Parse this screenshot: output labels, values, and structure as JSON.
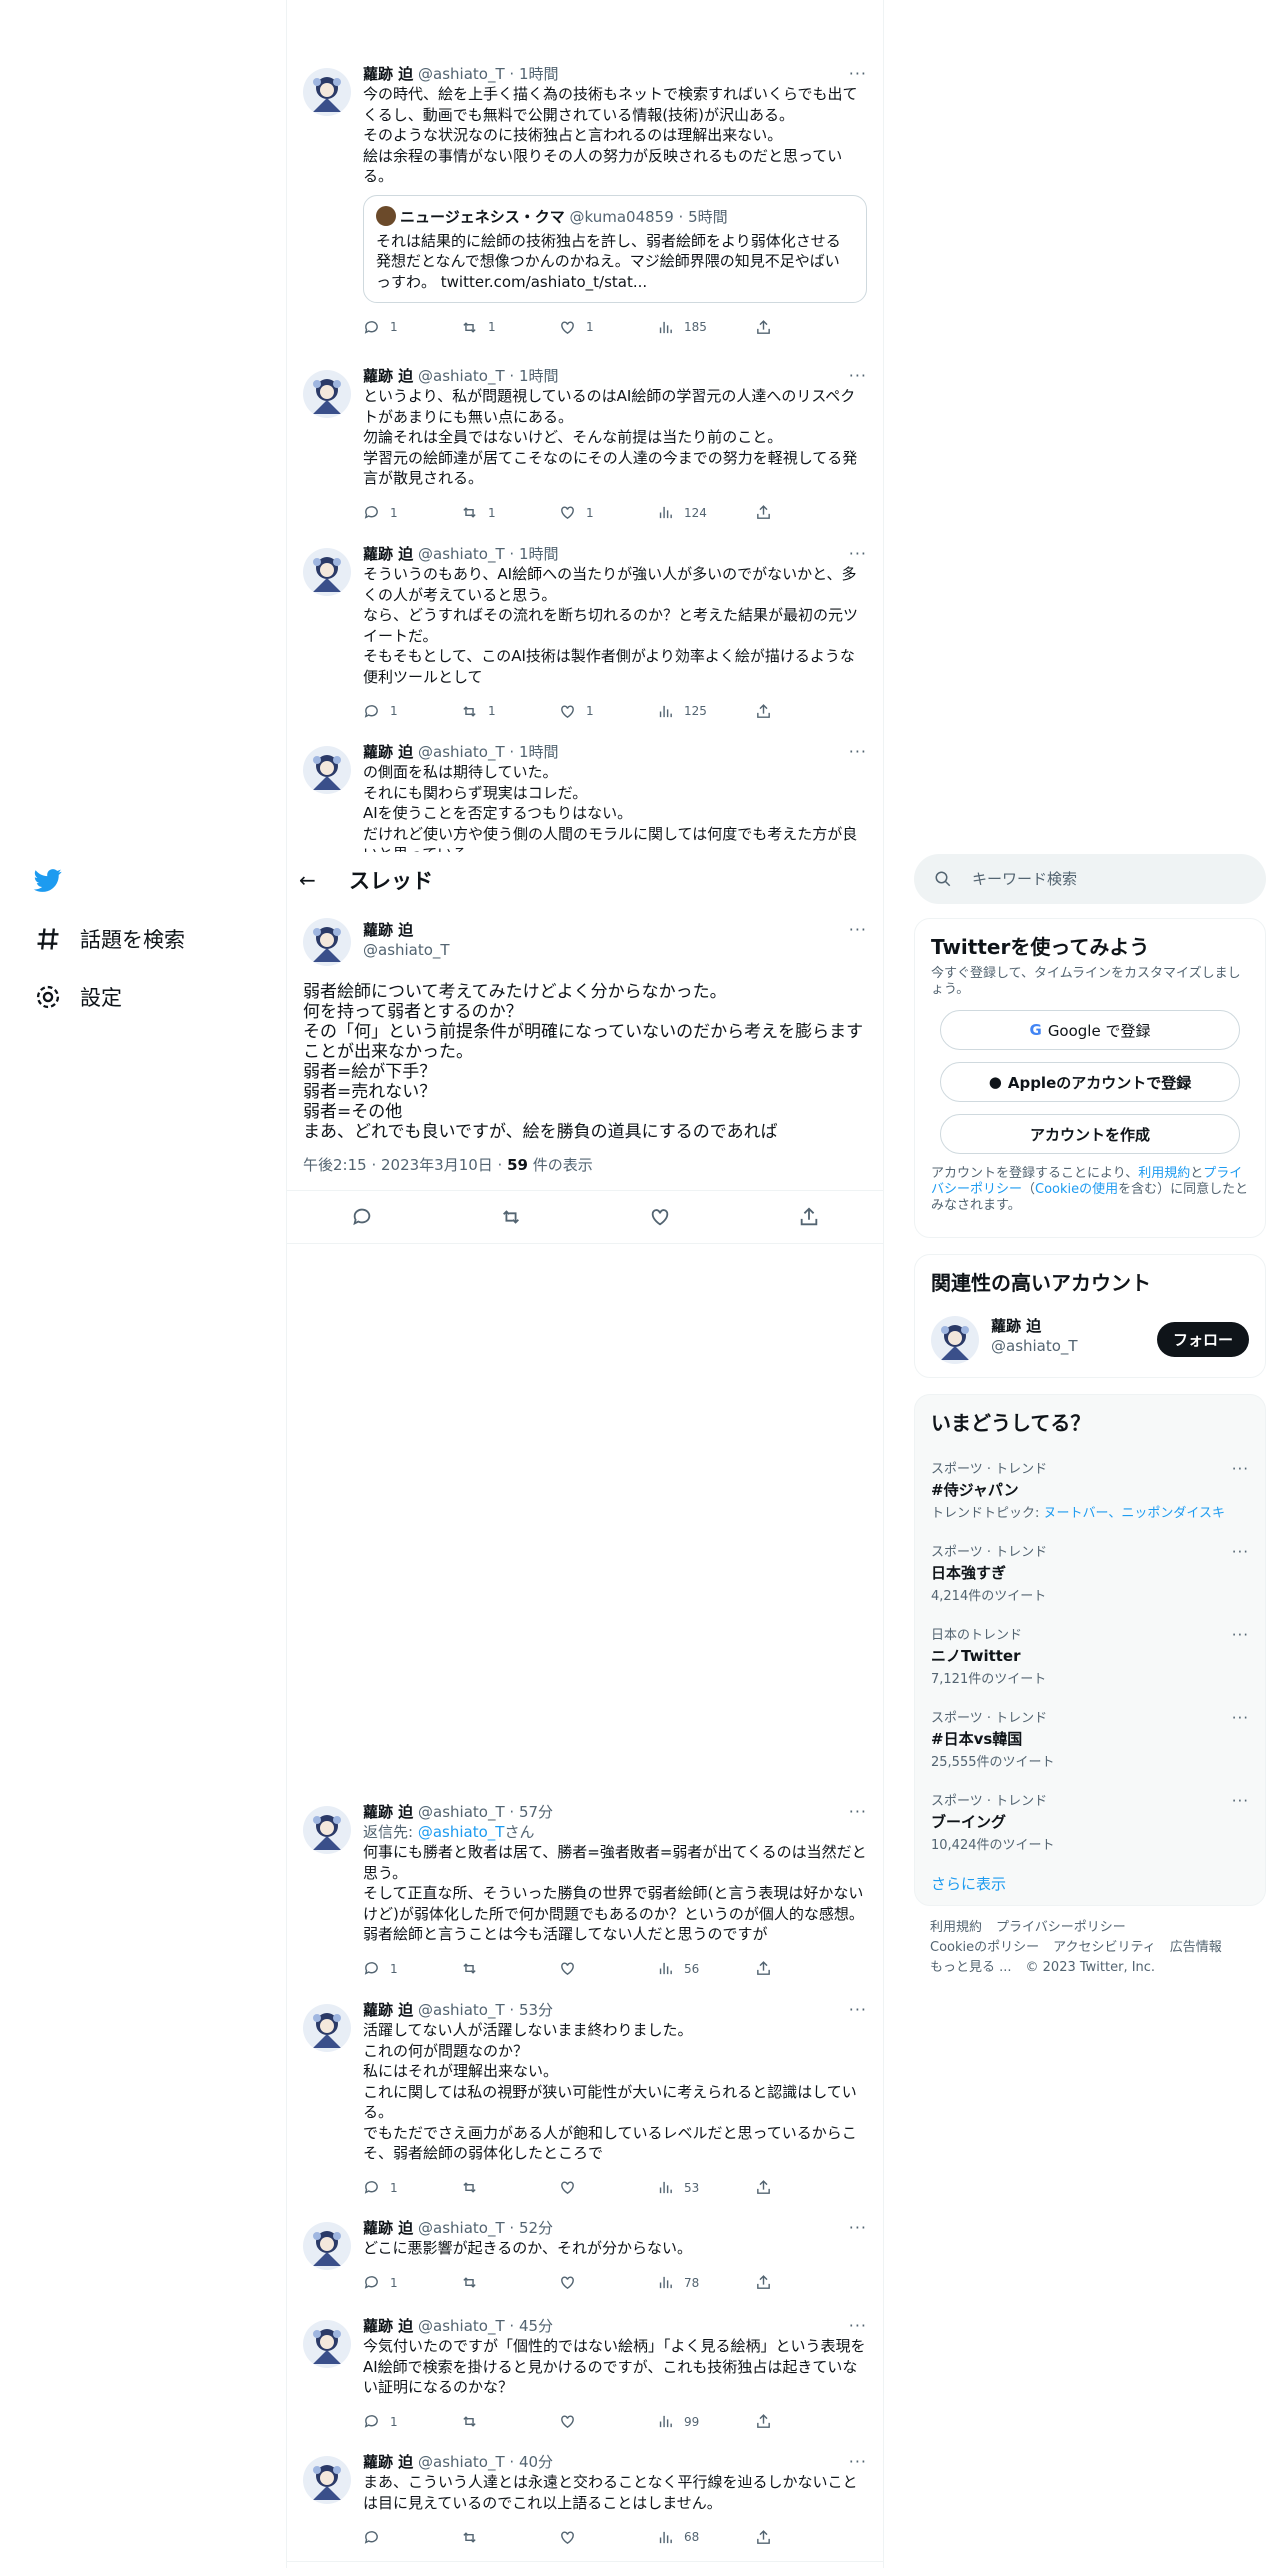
{
  "nav": {
    "items": [
      {
        "label": "話題を検索"
      },
      {
        "label": "設定"
      }
    ]
  },
  "header": {
    "title": "スレッド"
  },
  "author": {
    "name": "蘿跡 迫",
    "handle": "@ashiato_T"
  },
  "tweets_top": [
    {
      "time": "1時間",
      "text": "今の時代、絵を上手く描く為の技術もネットで検索すればいくらでも出てくるし、動画でも無料で公開されている情報(技術)が沢山ある。\nそのような状況なのに技術独占と言われるのは理解出来ない。\n絵は余程の事情がない限りその人の努力が反映されるものだと思っている。",
      "quote": {
        "name": "ニュージェネシス・クマ",
        "handle": "@kuma04859",
        "time": "5時間",
        "text": "それは結果的に絵師の技術独占を許し、弱者絵師をより弱体化させる発想だとなんで想像つかんのかねえ。マジ絵師界隈の知見不足やばいっすわ。 twitter.com/ashiato_t/stat..."
      },
      "reply": "1",
      "retweet": "1",
      "like": "1",
      "views": "185"
    },
    {
      "time": "1時間",
      "text": "というより、私が問題視しているのはAI絵師の学習元の人達へのリスペクトがあまりにも無い点にある。\n勿論それは全員ではないけど、そんな前提は当たり前のこと。\n学習元の絵師達が居てこそなのにその人達の今までの努力を軽視してる発言が散見される。",
      "reply": "1",
      "retweet": "1",
      "like": "1",
      "views": "124"
    },
    {
      "time": "1時間",
      "text": "そういうのもあり、AI絵師への当たりが強い人が多いのでがないかと、多くの人が考えていると思う。\nなら、どうすればその流れを断ち切れるのか？と考えた結果が最初の元ツイートだ。\nそもそもとして、このAI技術は製作者側がより効率よく絵が描けるような便利ツールとして",
      "reply": "1",
      "retweet": "1",
      "like": "1",
      "views": "125"
    },
    {
      "time": "1時間",
      "text": "の側面を私は期待していた。\nそれにも関わらず現実はコレだ。\nAIを使うことを否定するつもりはない。\nだけれど使い方や使う側の人間のモラルに関しては何度でも考えた方が良いと思っている。"
    }
  ],
  "main_tweet": {
    "text": "弱者絵師について考えてみたけどよく分からなかった。\n何を持って弱者とするのか？\nその「何」という前提条件が明確になっていないのだから考えを膨らますことが出来なかった。\n弱者=絵が下手？\n弱者=売れない？\n弱者=その他\nまあ、どれでも良いですが、絵を勝負の道具にするのであれば",
    "timestamp": "午後2:15 · 2023年3月10日 · ",
    "views": "59",
    "views_label": " 件の表示"
  },
  "tweets_bottom": [
    {
      "time": "57分",
      "reply_to_label": "返信先: ",
      "reply_to_handle": "@ashiato_T",
      "reply_to_suffix": "さん",
      "text": "何事にも勝者と敗者は居て、勝者=強者敗者=弱者が出てくるのは当然だと思う。\nそして正直な所、そういった勝負の世界で弱者絵師(と言う表現は好かないけど)が弱体化した所で何か問題でもあるのか？というのが個人的な感想。\n弱者絵師と言うことは今も活躍してない人だと思うのですが",
      "reply": "1",
      "views": "56"
    },
    {
      "time": "53分",
      "text": "活躍してない人が活躍しないまま終わりました。\nこれの何が問題なのか？\n私にはそれが理解出来ない。\nこれに関しては私の視野が狭い可能性が大いに考えられると認識はしている。\nでもただでさえ画力がある人が飽和しているレベルだと思っているからこそ、弱者絵師の弱体化したところで",
      "reply": "1",
      "views": "53"
    },
    {
      "time": "52分",
      "text": "どこに悪影響が起きるのか、それが分からない。",
      "reply": "1",
      "views": "78"
    },
    {
      "time": "45分",
      "text": "今気付いたのですが「個性的ではない絵柄」「よく見る絵柄」という表現をAI絵師で検索を掛けると見かけるのですが、これも技術独占は起きていない証明になるのかな？",
      "reply": "1",
      "views": "99"
    },
    {
      "time": "40分",
      "text": "まあ、こういう人達とは永遠と交わることなく平行線を辿るしかないことは目に見えているのでこれ以上語ることはしません。",
      "views": "68"
    }
  ],
  "search": {
    "placeholder": "キーワード検索"
  },
  "signup": {
    "title": "Twitterを使ってみよう",
    "desc": "今すぐ登録して、タイムラインをカスタマイズしましょう。",
    "google": "Google で登録",
    "apple": "Appleのアカウントで登録",
    "create": "アカウントを作成",
    "legal_1": "アカウントを登録することにより、",
    "legal_terms": "利用規約",
    "legal_2": "と",
    "legal_privacy": "プライバシーポリシー",
    "legal_3": "（",
    "legal_cookie": "Cookieの使用",
    "legal_4": "を含む）に同意したとみなされます。"
  },
  "related": {
    "title": "関連性の高いアカウント",
    "follow": "フォロー"
  },
  "trends": {
    "title": "いまどうしてる？",
    "items": [
      {
        "cat": "スポーツ · トレンド",
        "name": "#侍ジャパン",
        "extra_label": "トレンドトピック: ",
        "extra_links": "ヌートバー、ニッポンダイスキ"
      },
      {
        "cat": "スポーツ · トレンド",
        "name": "日本強すぎ",
        "count": "4,214件のツイート"
      },
      {
        "cat": "日本のトレンド",
        "name": "ニノTwitter",
        "count": "7,121件のツイート"
      },
      {
        "cat": "スポーツ · トレンド",
        "name": "#日本vs韓国",
        "count": "25,555件のツイート"
      },
      {
        "cat": "スポーツ · トレンド",
        "name": "ブーイング",
        "count": "10,424件のツイート"
      }
    ],
    "show_more": "さらに表示"
  },
  "footer": {
    "terms": "利用規約",
    "privacy": "プライバシーポリシー",
    "cookie": "Cookieのポリシー",
    "access": "アクセシビリティ",
    "ads": "広告情報",
    "more": "もっと見る ...",
    "copy": "© 2023 Twitter, Inc."
  },
  "colors": {
    "accent": "#1d9bf0",
    "text": "#0f1419",
    "muted": "#536471"
  }
}
